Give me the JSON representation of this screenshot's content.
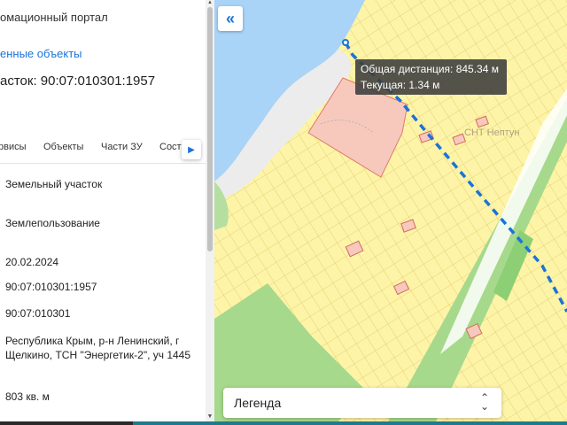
{
  "panel": {
    "portal_title": "омационный портал",
    "selected_link": "енные объекты",
    "parcel_title": "асток: 90:07:010301:1957",
    "tabs": [
      {
        "label": "рвисы"
      },
      {
        "label": "Объекты"
      },
      {
        "label": "Части ЗУ"
      },
      {
        "label": "Соста"
      }
    ],
    "fields": [
      "Земельный участок",
      "Землепользование",
      "20.02.2024",
      "90:07:010301:1957",
      "90:07:010301",
      "Республика Крым, р-н Ленинский, г Щелкино, ТСН \"Энергетик-2\", уч 1445",
      "803 кв. м"
    ]
  },
  "map": {
    "area_label": "СНТ Нептун",
    "tooltip": {
      "total": "Общая дистанция: 845.34 м",
      "current": "Текущая: 1.34 м"
    },
    "legend_label": "Легенда",
    "colors": {
      "parcel_fill": "#fdf4a8",
      "parcel_stroke": "#e0c35a",
      "water": "#a9d3f7",
      "green": "#a6d98b",
      "selected_fill": "#f7c9bd",
      "measure_line": "#1a73d9"
    }
  }
}
